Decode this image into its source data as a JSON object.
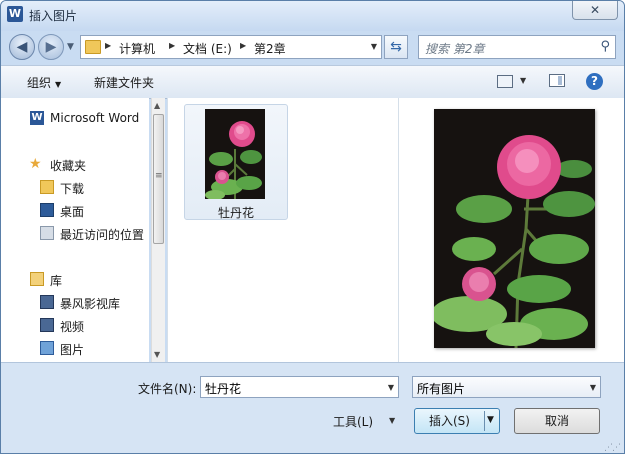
{
  "window": {
    "title": "插入图片",
    "app_icon": "W",
    "close_symbol": "✕"
  },
  "nav": {
    "breadcrumbs": [
      "计算机",
      "文档 (E:)",
      "第2章"
    ],
    "search_placeholder": "搜索 第2章"
  },
  "toolbar": {
    "organize": "组织",
    "new_folder": "新建文件夹",
    "help": "?"
  },
  "sidebar": {
    "items": [
      {
        "label": "Microsoft Word",
        "icon": "word-icon"
      },
      {
        "label": "收藏夹",
        "icon": "star-icon"
      },
      {
        "label": "下载",
        "icon": "downloads-folder-icon"
      },
      {
        "label": "桌面",
        "icon": "desktop-icon"
      },
      {
        "label": "最近访问的位置",
        "icon": "recent-places-icon"
      },
      {
        "label": "库",
        "icon": "library-icon"
      },
      {
        "label": "暴风影视库",
        "icon": "video-library-icon"
      },
      {
        "label": "视频",
        "icon": "video-icon"
      },
      {
        "label": "图片",
        "icon": "pictures-icon"
      }
    ]
  },
  "files": [
    {
      "name": "牡丹花"
    }
  ],
  "footer": {
    "filename_label": "文件名(N):",
    "filename_value": "牡丹花",
    "filetype_value": "所有图片",
    "tools_label": "工具(L)",
    "insert_label": "插入(S)",
    "cancel_label": "取消"
  },
  "colors": {
    "accent": "#2b5797",
    "flower_pink": "#e04b8c",
    "leaf_green": "#4a9a3c"
  }
}
